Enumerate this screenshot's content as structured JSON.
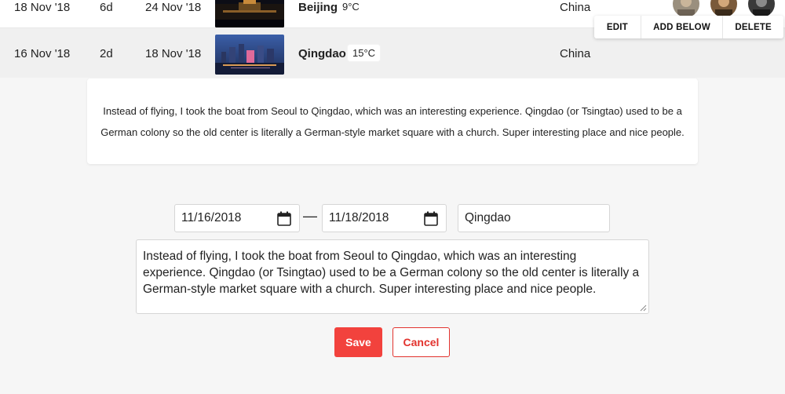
{
  "trips": [
    {
      "start": "18 Nov '18",
      "duration": "6d",
      "end": "24 Nov '18",
      "city": "Beijing",
      "temp": "9°C",
      "country": "China"
    },
    {
      "start": "16 Nov '18",
      "duration": "2d",
      "end": "18 Nov '18",
      "city": "Qingdao",
      "temp": "15°C",
      "country": "China"
    }
  ],
  "row_actions": {
    "edit": "EDIT",
    "add_below": "ADD BELOW",
    "delete": "DELETE"
  },
  "note": "Instead of flying, I took the boat from Seoul to Qingdao, which was an interesting experience. Qingdao (or Tsingtao) used to be a German colony so the old center is literally a German-style market square with a church. Super interesting place and nice people.",
  "form": {
    "date_from": "11/16/2018",
    "separator": "—",
    "date_to": "11/18/2018",
    "city": "Qingdao",
    "description": "Instead of flying, I took the boat from Seoul to Qingdao, which was an interesting experience. Qingdao (or Tsingtao) used to be a German colony so the old center is literally a German-style market square with a church. Super interesting place and nice people.",
    "save_label": "Save",
    "cancel_label": "Cancel"
  },
  "colors": {
    "primary": "#f2423d",
    "background": "#f6f6f6"
  }
}
